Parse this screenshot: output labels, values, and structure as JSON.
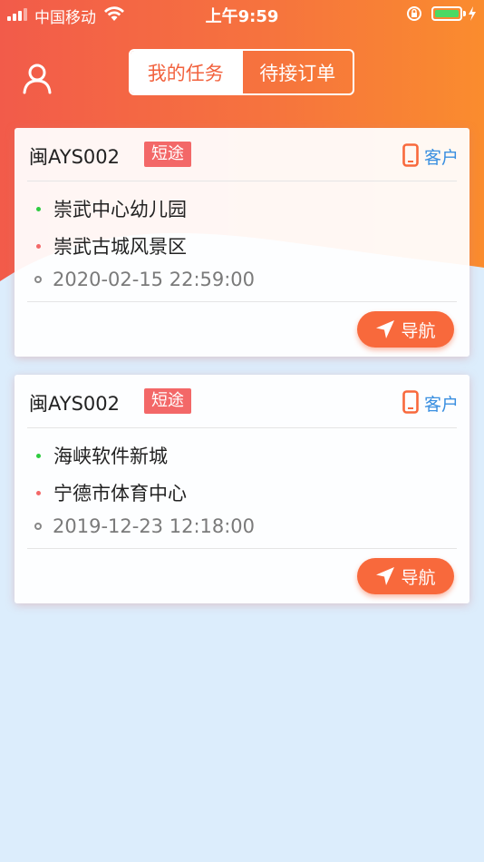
{
  "status_bar": {
    "carrier": "中国移动",
    "time": "上午9:59",
    "battery_color": "#4cd964"
  },
  "header": {
    "tabs": [
      {
        "label": "我的任务",
        "active": true
      },
      {
        "label": "待接订单",
        "active": false
      }
    ],
    "gradient": [
      "#f25b4a",
      "#fa8c2e"
    ]
  },
  "orders": [
    {
      "plate": "闽AYS002",
      "tag": "短途",
      "client_label": "客户",
      "origin": "崇武中心幼儿园",
      "destination": "崇武古城风景区",
      "datetime": "2020-02-15 22:59:00",
      "nav_label": "导航"
    },
    {
      "plate": "闽AYS002",
      "tag": "短途",
      "client_label": "客户",
      "origin": "海峡软件新城",
      "destination": "宁德市体育中心",
      "datetime": "2019-12-23 12:18:00",
      "nav_label": "导航"
    }
  ],
  "colors": {
    "accent": "#f8693c",
    "tag": "#f36868",
    "link": "#3a8fe0",
    "background": "#dcedfc"
  }
}
